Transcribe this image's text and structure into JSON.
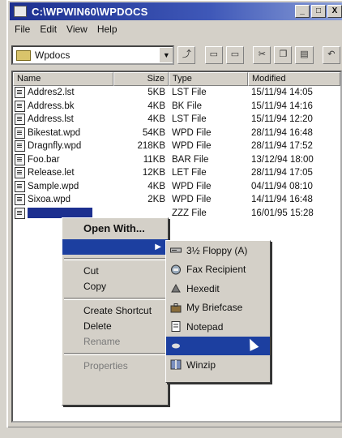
{
  "window": {
    "title": "C:\\WPWIN60\\WPDOCS",
    "min": "_",
    "max": "□",
    "close": "X"
  },
  "menu": [
    "File",
    "Edit",
    "View",
    "Help"
  ],
  "toolbar": {
    "folder": "Wpdocs"
  },
  "columns": {
    "name": "Name",
    "size": "Size",
    "type": "Type",
    "modified": "Modified"
  },
  "files": [
    {
      "name": "Addres2.lst",
      "size": "5KB",
      "type": "LST File",
      "modified": "15/11/94 14:05"
    },
    {
      "name": "Address.bk",
      "size": "4KB",
      "type": "BK File",
      "modified": "15/11/94 14:16"
    },
    {
      "name": "Address.lst",
      "size": "4KB",
      "type": "LST File",
      "modified": "15/11/94 12:20"
    },
    {
      "name": "Bikestat.wpd",
      "size": "54KB",
      "type": "WPD File",
      "modified": "28/11/94 16:48"
    },
    {
      "name": "Dragnfly.wpd",
      "size": "218KB",
      "type": "WPD File",
      "modified": "28/11/94 17:52"
    },
    {
      "name": "Foo.bar",
      "size": "11KB",
      "type": "BAR File",
      "modified": "13/12/94 18:00"
    },
    {
      "name": "Release.let",
      "size": "12KB",
      "type": "LET File",
      "modified": "28/11/94 17:05"
    },
    {
      "name": "Sample.wpd",
      "size": "4KB",
      "type": "WPD File",
      "modified": "04/11/94 08:10"
    },
    {
      "name": "Sixoa.wpd",
      "size": "2KB",
      "type": "WPD File",
      "modified": "14/11/94 16:48"
    },
    {
      "name": "",
      "size": "",
      "type": "ZZZ File",
      "modified": "16/01/95 15:28"
    }
  ],
  "context_menu": {
    "open_with": "Open With...",
    "cut": "Cut",
    "copy": "Copy",
    "create_shortcut": "Create Shortcut",
    "delete": "Delete",
    "rename": "Rename",
    "properties": "Properties"
  },
  "send_to_menu": [
    "3½ Floppy (A)",
    "Fax Recipient",
    "Hexedit",
    "My Briefcase",
    "Notepad",
    "",
    "Winzip"
  ]
}
